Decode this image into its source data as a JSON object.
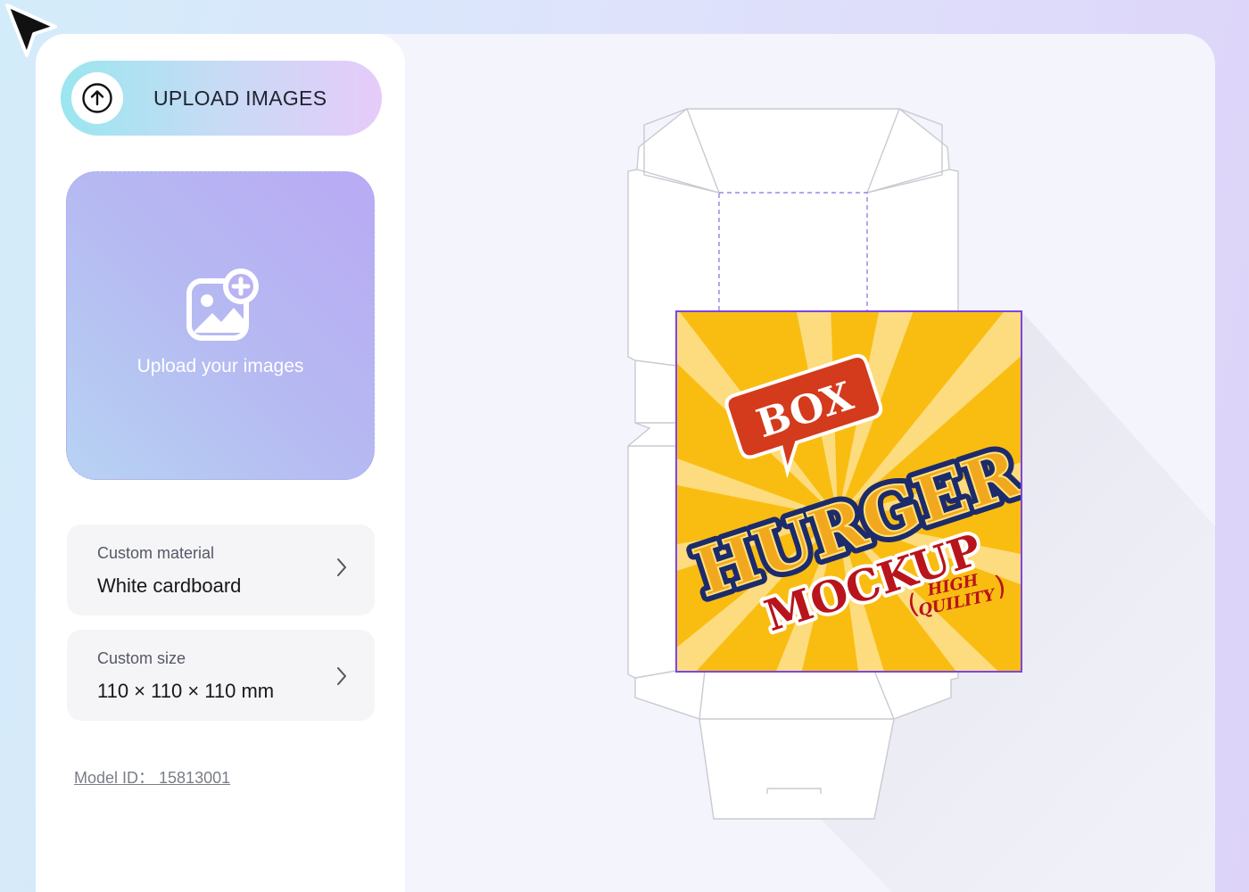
{
  "sidebar": {
    "upload_button": {
      "label": "UPLOAD IMAGES",
      "icon": "arrow-up-circle-icon"
    },
    "dropzone": {
      "label": "Upload your images",
      "icon": "add-image-icon"
    },
    "material": {
      "caption": "Custom material",
      "value": "White cardboard"
    },
    "size": {
      "caption": "Custom size",
      "value": "110 × 110 × 110 mm"
    },
    "model_id": "Model ID： 15813001"
  },
  "artwork": {
    "badge": "BOX",
    "title": "HURGER",
    "subtitle": "MOCKUP",
    "tagline_line1": "HIGH",
    "tagline_line2": "QUILITY",
    "colors": {
      "background": "#f9bd12",
      "ray": "#fde08a",
      "red": "#b8141c",
      "navy": "#1c2b6b"
    }
  },
  "colors": {
    "accent": "#7a45e8",
    "upload_gradient_start": "#9ae6ef",
    "upload_gradient_end": "#e6cbfa"
  }
}
